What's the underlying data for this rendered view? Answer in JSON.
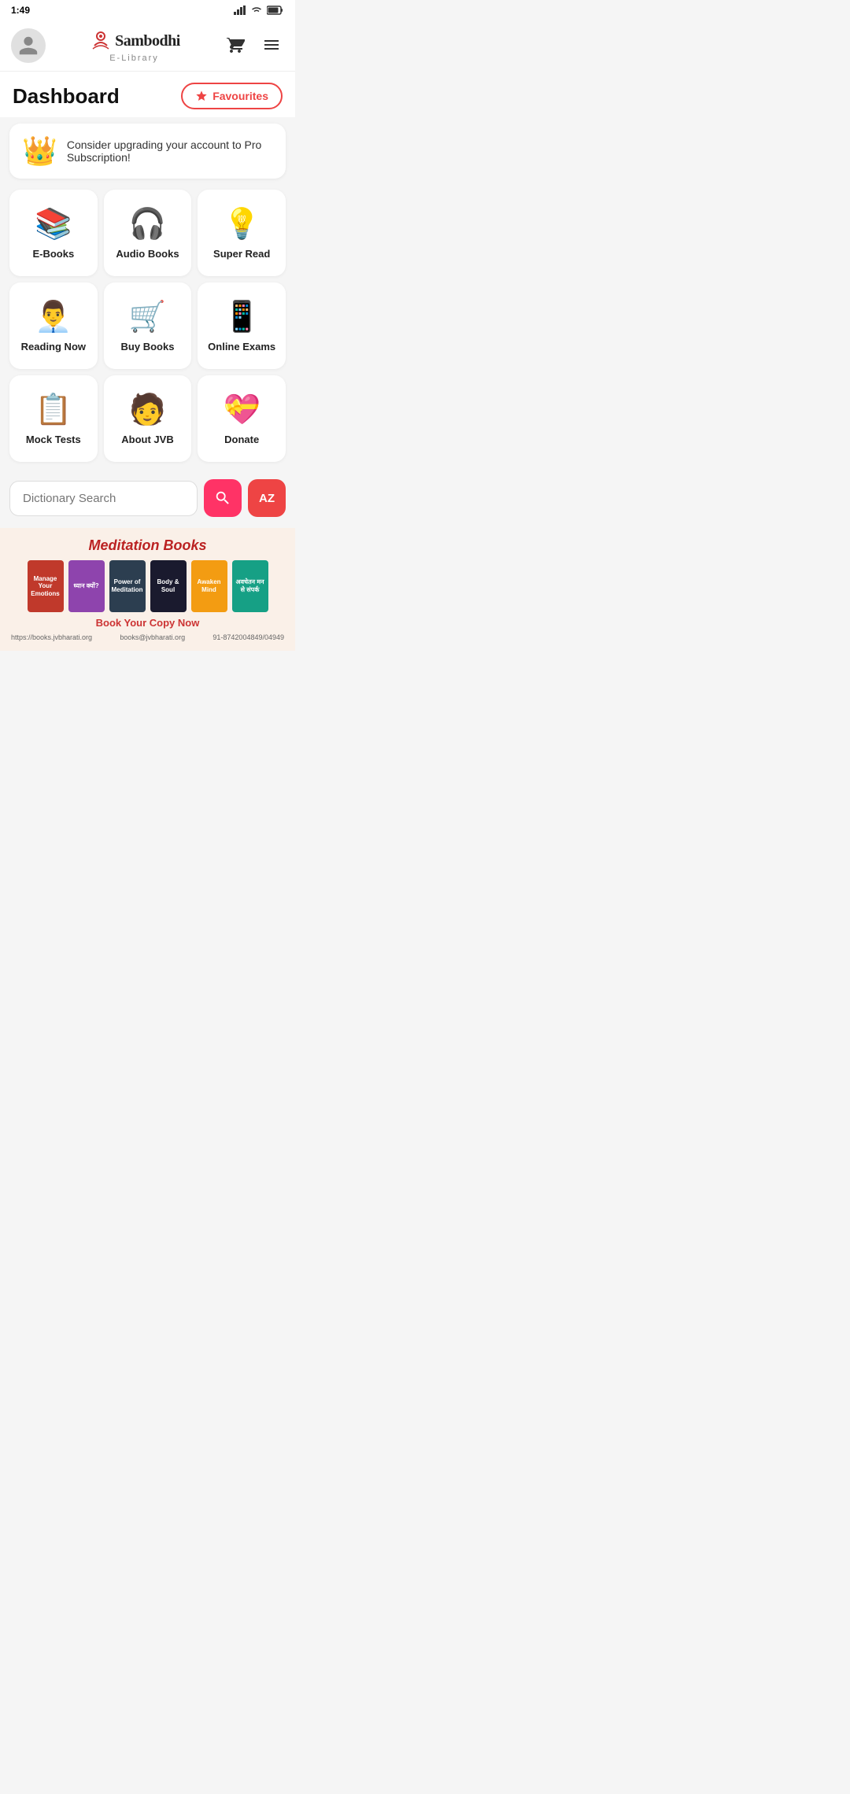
{
  "statusBar": {
    "time": "1:49",
    "icons": [
      "signal",
      "wifi",
      "battery"
    ]
  },
  "header": {
    "brand": "Sambodhi",
    "brandDot": "•",
    "subtext": "E-Library",
    "cartIcon": "cart-icon",
    "menuIcon": "menu-icon"
  },
  "dashboard": {
    "title": "Dashboard",
    "favouritesLabel": "Favourites"
  },
  "upgradeBanner": {
    "icon": "👑",
    "text": "Consider upgrading your account to Pro Subscription!"
  },
  "gridItems": [
    {
      "id": "ebooks",
      "icon": "📚",
      "label": "E-Books"
    },
    {
      "id": "audiobooks",
      "icon": "🎧",
      "label": "Audio Books"
    },
    {
      "id": "superread",
      "icon": "💡",
      "label": "Super Read"
    },
    {
      "id": "readingnow",
      "icon": "👨‍💼",
      "label": "Reading Now"
    },
    {
      "id": "buybooks",
      "icon": "🛒",
      "label": "Buy Books"
    },
    {
      "id": "onlineexams",
      "icon": "📱",
      "label": "Online Exams"
    },
    {
      "id": "mocktests",
      "icon": "📋",
      "label": "Mock Tests"
    },
    {
      "id": "aboutjvb",
      "icon": "🧑",
      "label": "About JVB"
    },
    {
      "id": "donate",
      "icon": "💝",
      "label": "Donate"
    }
  ],
  "dictionary": {
    "placeholder": "Dictionary Search",
    "searchIconLabel": "🔍",
    "azIconLabel": "AZ"
  },
  "banner": {
    "title": "Meditation Books",
    "copyNowText": "Book Your Copy Now",
    "books": [
      {
        "color": "#c0392b",
        "label": "Manage Your Emotions"
      },
      {
        "color": "#8e44ad",
        "label": "ध्यान क्यों?"
      },
      {
        "color": "#2c3e50",
        "label": "Power of Meditation"
      },
      {
        "color": "#1a1a2e",
        "label": "Body & Soul"
      },
      {
        "color": "#f39c12",
        "label": "Awaken Mind"
      },
      {
        "color": "#16a085",
        "label": "अवचेतन मन से संपर्क"
      }
    ],
    "footerLeft": "https://books.jvbharati.org",
    "footerCenter": "books@jvbharati.org",
    "footerRight": "91-8742004849/04949"
  }
}
